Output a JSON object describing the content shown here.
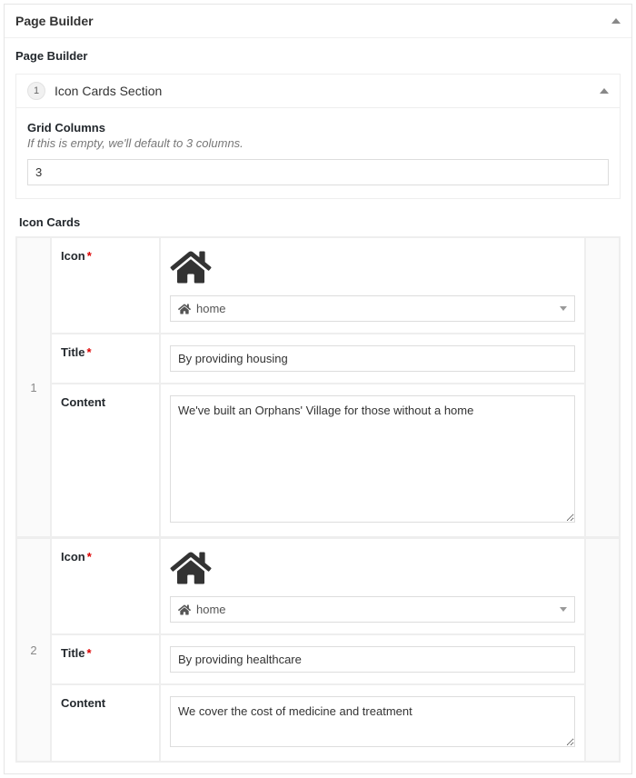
{
  "panel": {
    "title": "Page Builder"
  },
  "builder": {
    "subtitle": "Page Builder",
    "section_number": "1",
    "section_name": "Icon Cards Section",
    "grid_label": "Grid Columns",
    "grid_help": "If this is empty, we'll default to 3 columns.",
    "grid_value": "3",
    "cards_label": "Icon Cards",
    "field_labels": {
      "icon": "Icon",
      "title": "Title",
      "content": "Content"
    },
    "required_marker": "*",
    "cards": [
      {
        "num": "1",
        "icon_value": "home",
        "title": "By providing housing",
        "content": "We've built an Orphans' Village for those without a home"
      },
      {
        "num": "2",
        "icon_value": "home",
        "title": "By providing healthcare",
        "content": "We cover the cost of medicine and treatment"
      }
    ]
  }
}
